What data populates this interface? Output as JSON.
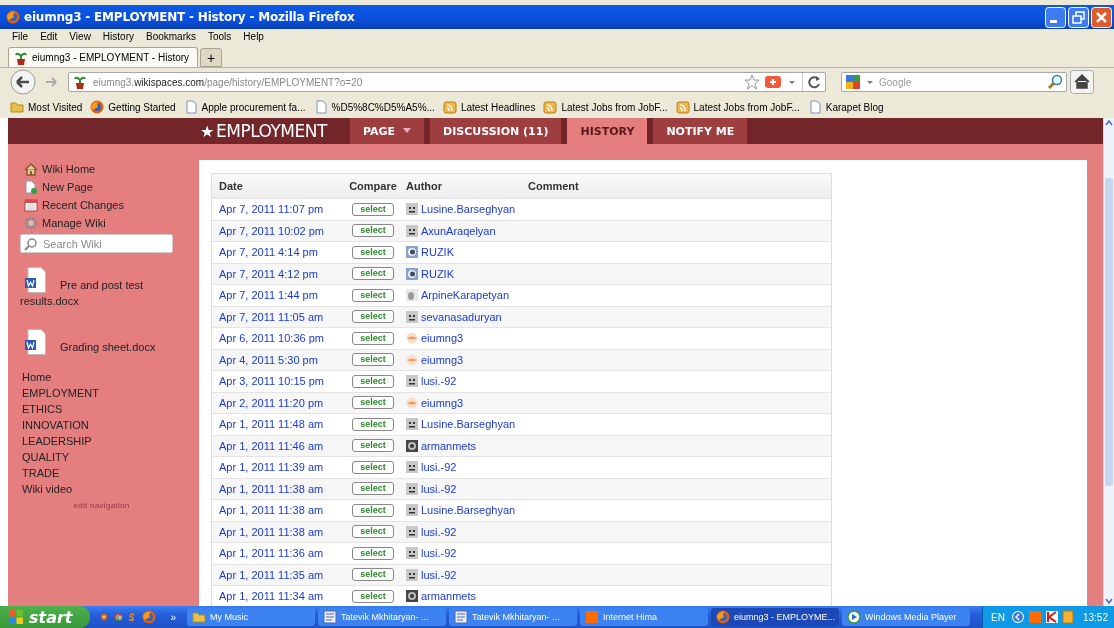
{
  "window": {
    "title": "eiumng3 - EMPLOYMENT - History - Mozilla Firefox"
  },
  "menu": [
    "File",
    "Edit",
    "View",
    "History",
    "Bookmarks",
    "Tools",
    "Help"
  ],
  "tabs": [
    {
      "label": "eiumng3 - EMPLOYMENT - History",
      "selected": true
    }
  ],
  "new_tab": "+",
  "address_bar": {
    "value": "eiumng3.**wikispaces.com**/page/history/EMPLOYMENT?o=20"
  },
  "search_bar": {
    "placeholder": "Google"
  },
  "bookmarks": [
    {
      "label": "Most Visited",
      "kind": "folder"
    },
    {
      "label": "Getting Started",
      "kind": "firefox"
    },
    {
      "label": "Apple procurement fa...",
      "kind": "page"
    },
    {
      "label": "%D5%8C%D5%A5%...",
      "kind": "page"
    },
    {
      "label": "Latest Headlines",
      "kind": "feed"
    },
    {
      "label": "Latest Jobs from JobF...",
      "kind": "feed"
    },
    {
      "label": "Latest Jobs from JobF...",
      "kind": "feed"
    },
    {
      "label": "Karapet Blog",
      "kind": "page"
    }
  ],
  "wiki": {
    "star": "★",
    "title": "EMPLOYMENT",
    "tabs": [
      {
        "label": "PAGE",
        "dropdown": true,
        "selected": false
      },
      {
        "label": "DISCUSSION (11)",
        "dropdown": false,
        "selected": false
      },
      {
        "label": "HISTORY",
        "dropdown": false,
        "selected": true
      },
      {
        "label": "NOTIFY ME",
        "dropdown": false,
        "selected": false
      }
    ]
  },
  "sidebar": {
    "actions": [
      {
        "label": "Wiki Home",
        "kind": "home"
      },
      {
        "label": "New Page",
        "kind": "new"
      },
      {
        "label": "Recent Changes",
        "kind": "calendar"
      },
      {
        "label": "Manage Wiki",
        "kind": "gear"
      }
    ],
    "search": {
      "placeholder": "Search Wiki"
    },
    "files": [
      "Pre and post test results.docx",
      "Grading sheet.docx"
    ],
    "nav": [
      "Home",
      "EMPLOYMENT",
      "ETHICS",
      "INNOVATION",
      "LEADERSHIP",
      "QUALITY",
      "TRADE",
      "Wiki video"
    ],
    "edit_link": "edit navigation"
  },
  "history": {
    "columns": [
      "Date",
      "Compare",
      "Author",
      "Comment"
    ],
    "rows": [
      {
        "date": "Apr 7, 2011 11:07 pm",
        "compare": "select",
        "author": "Lusine.Barseghyan",
        "kind": "blank"
      },
      {
        "date": "Apr 7, 2011 10:02 pm",
        "compare": "select",
        "author": "AxunAraqelyan",
        "kind": "blank"
      },
      {
        "date": "Apr 7, 2011 4:14 pm",
        "compare": "select",
        "author": "RUZIK",
        "kind": "blue"
      },
      {
        "date": "Apr 7, 2011 4:12 pm",
        "compare": "select",
        "author": "RUZIK",
        "kind": "blue"
      },
      {
        "date": "Apr 7, 2011 1:44 pm",
        "compare": "select",
        "author": "ArpineKarapetyan",
        "kind": "grey"
      },
      {
        "date": "Apr 7, 2011 11:05 am",
        "compare": "select",
        "author": "sevanasaduryan",
        "kind": "blank"
      },
      {
        "date": "Apr 6, 2011 10:36 pm",
        "compare": "select",
        "author": "eiumng3",
        "kind": "orange"
      },
      {
        "date": "Apr 4, 2011 5:30 pm",
        "compare": "select",
        "author": "eiumng3",
        "kind": "orange"
      },
      {
        "date": "Apr 3, 2011 10:15 pm",
        "compare": "select",
        "author": "lusi.-92",
        "kind": "blank"
      },
      {
        "date": "Apr 2, 2011 11:20 pm",
        "compare": "select",
        "author": "eiumng3",
        "kind": "orange"
      },
      {
        "date": "Apr 1, 2011 11:48 am",
        "compare": "select",
        "author": "Lusine.Barseghyan",
        "kind": "blank"
      },
      {
        "date": "Apr 1, 2011 11:46 am",
        "compare": "select",
        "author": "armanmets",
        "kind": "dark"
      },
      {
        "date": "Apr 1, 2011 11:39 am",
        "compare": "select",
        "author": "lusi.-92",
        "kind": "blank"
      },
      {
        "date": "Apr 1, 2011 11:38 am",
        "compare": "select",
        "author": "lusi.-92",
        "kind": "blank"
      },
      {
        "date": "Apr 1, 2011 11:38 am",
        "compare": "select",
        "author": "Lusine.Barseghyan",
        "kind": "blank"
      },
      {
        "date": "Apr 1, 2011 11:38 am",
        "compare": "select",
        "author": "lusi.-92",
        "kind": "blank"
      },
      {
        "date": "Apr 1, 2011 11:36 am",
        "compare": "select",
        "author": "lusi.-92",
        "kind": "blank"
      },
      {
        "date": "Apr 1, 2011 11:35 am",
        "compare": "select",
        "author": "lusi.-92",
        "kind": "blank"
      },
      {
        "date": "Apr 1, 2011 11:34 am",
        "compare": "select",
        "author": "armanmets",
        "kind": "dark"
      }
    ]
  },
  "taskbar": {
    "start": "start",
    "more": "»",
    "buttons": [
      {
        "label": "My Music",
        "kind": "folder",
        "selected": false
      },
      {
        "label": "Tatevik Mkhitaryan- ...",
        "kind": "doc",
        "selected": false
      },
      {
        "label": "Tatevik Mkhitaryan- ...",
        "kind": "doc",
        "selected": false
      },
      {
        "label": "Internet Hima",
        "kind": "orange",
        "selected": false
      },
      {
        "label": "eiumng3 - EMPLOYME...",
        "kind": "firefox",
        "selected": true
      },
      {
        "label": "Windows Media Player",
        "kind": "media",
        "selected": false
      }
    ],
    "language": "EN",
    "time": "13:52"
  }
}
